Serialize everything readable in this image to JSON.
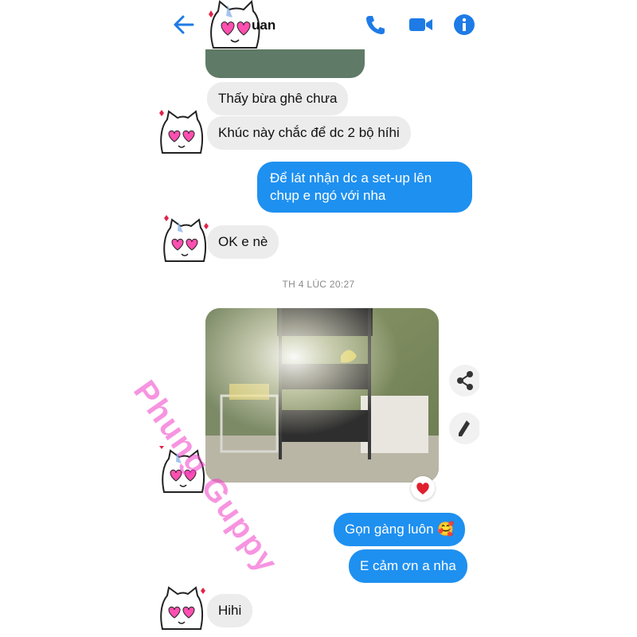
{
  "header": {
    "contact_name_partial": "uan",
    "icons": {
      "back": "back-arrow-icon",
      "call": "phone-icon",
      "video": "video-camera-icon",
      "info": "info-icon"
    },
    "accent": "#1e7be6"
  },
  "messages": [
    {
      "from": "them",
      "text": "Thấy bừa ghê chưa"
    },
    {
      "from": "them",
      "text": "Khúc này chắc để dc 2 bộ híhi"
    },
    {
      "from": "me",
      "line1": "Để lát nhận dc a set-up lên",
      "line2": "chụp e ngó với nha"
    },
    {
      "from": "them",
      "text": "OK e nè"
    },
    {
      "from": "me",
      "text": "Gọn gàng luôn",
      "emoji": "🥰"
    },
    {
      "from": "me",
      "text": "E cảm ơn a nha"
    },
    {
      "from": "them",
      "text": "Hihi"
    }
  ],
  "timestamp": "TH 4 LÚC 20:27",
  "photo": {
    "description_icon": "aquarium-shelf-photo"
  },
  "side_actions": {
    "share": "share-icon",
    "edit": "pencil-icon"
  },
  "reaction": {
    "icon": "heart-icon",
    "color": "#e0202e"
  },
  "watermark": "Phung Guppy",
  "colors": {
    "outgoing_bubble": "#1e90f0",
    "incoming_bubble": "#ececec"
  }
}
